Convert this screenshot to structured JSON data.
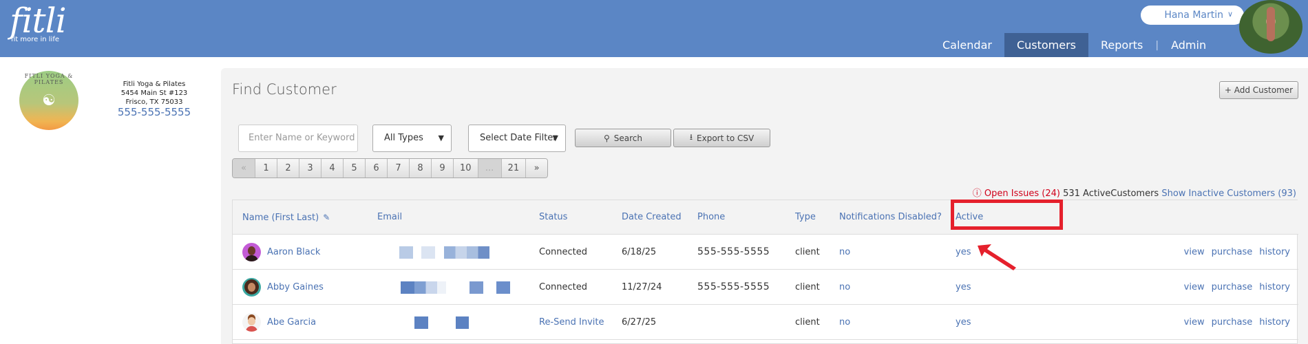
{
  "header": {
    "logo": "fitli",
    "tagline": "fit more in life",
    "user_name": "Hana Martin",
    "nav": [
      {
        "label": "Calendar",
        "active": false
      },
      {
        "label": "Customers",
        "active": true
      },
      {
        "label": "Reports",
        "active": false
      },
      {
        "label": "Admin",
        "active": false
      }
    ]
  },
  "studio": {
    "logo_text": "FITLI YOGA & PILATES",
    "name": "Fitli Yoga & Pilates",
    "address1": "5454 Main St #123",
    "address2": "Frisco, TX 75033",
    "phone": "555-555-5555"
  },
  "page": {
    "title": "Find Customer",
    "add_button": "+ Add Customer"
  },
  "filters": {
    "search_placeholder": "Enter Name or Keyword",
    "type_select": "All Types",
    "date_select": "Select Date Filter",
    "search_button": "Search",
    "export_button": "Export to CSV"
  },
  "pager": [
    "«",
    "1",
    "2",
    "3",
    "4",
    "5",
    "6",
    "7",
    "8",
    "9",
    "10",
    "...",
    "21",
    "»"
  ],
  "summary": {
    "open_issues": "Open Issues (24)",
    "active_count": "531 ActiveCustomers",
    "inactive_link": "Show Inactive Customers (93)"
  },
  "table": {
    "headers": {
      "name": "Name (First Last)",
      "email": "Email",
      "status": "Status",
      "date_created": "Date Created",
      "phone": "Phone",
      "type": "Type",
      "notifications": "Notifications Disabled?",
      "active": "Active"
    },
    "rows": [
      {
        "name": "Aaron Black",
        "status": "Connected",
        "date": "6/18/25",
        "phone": "555-555-5555",
        "type": "client",
        "notifications": "no",
        "active": "yes"
      },
      {
        "name": "Abby Gaines",
        "status": "Connected",
        "date": "11/27/24",
        "phone": "555-555-5555",
        "type": "client",
        "notifications": "no",
        "active": "yes"
      },
      {
        "name": "Abe Garcia",
        "status": "Re-Send Invite",
        "date": "6/27/25",
        "phone": "",
        "type": "client",
        "notifications": "no",
        "active": "yes"
      }
    ],
    "actions": {
      "view": "view",
      "purchase": "purchase",
      "history": "history"
    }
  },
  "colors": {
    "header_bg": "#5b86c5",
    "nav_active": "#3f6194",
    "link": "#4a72b3",
    "issues": "#d0021b",
    "highlight": "#e5202c"
  }
}
